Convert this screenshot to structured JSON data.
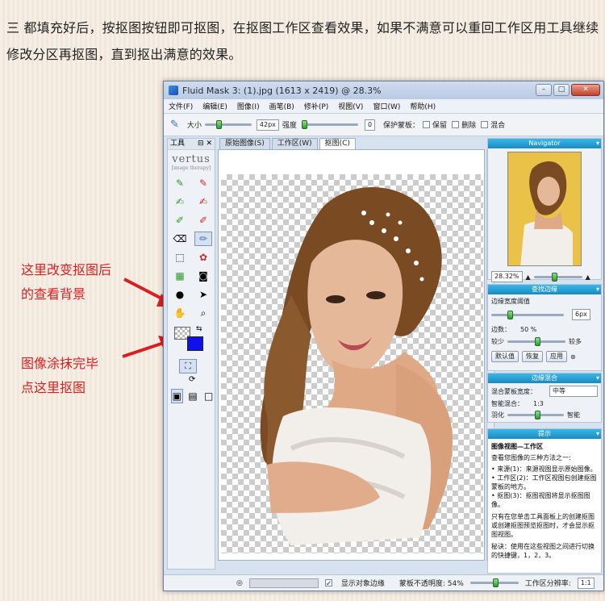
{
  "intro_text": "三 都填充好后，按抠图按钮即可抠图，在抠图工作区查看效果，如果不满意可以重回工作区用工具继续修改分区再抠图，直到抠出满意的效果。",
  "annotations": {
    "first_line1": "这里改变抠图后",
    "first_line2": "的查看背景",
    "second_line1": "图像涂抹完毕",
    "second_line2": "点这里抠图"
  },
  "window": {
    "title": "Fluid Mask 3: (1).jpg (1613 x 2419) @ 28.3%",
    "menu": [
      "文件(F)",
      "编辑(E)",
      "图像(I)",
      "画笔(B)",
      "修补(P)",
      "视图(V)",
      "窗口(W)",
      "帮助(H)"
    ],
    "options": {
      "size_label": "大小",
      "size_value": "42px",
      "strength_label": "强度",
      "strength_value": "0",
      "protect_label": "保护蒙板：",
      "keep_label": "保留",
      "delete_label": "删除",
      "blend_label": "混合"
    },
    "tools_title": "工具",
    "logo": "vertus",
    "logo_sub": "[image therapy]",
    "tabs": [
      "原始图像(S)",
      "工作区(W)",
      "抠图(C)"
    ],
    "navigator": {
      "title": "Navigator",
      "zoom": "28.32%"
    },
    "edge_panel": {
      "title": "查找边缘",
      "threshold_label": "边缘宽度阈值",
      "threshold_value": "6px",
      "contrast_label": "边数：",
      "contrast_value": "50 %",
      "less": "较少",
      "more": "较多",
      "btn_default": "默认值",
      "btn_restore": "恢复",
      "btn_apply": "应用"
    },
    "blend_panel": {
      "title": "边缘混合",
      "mask_label": "混合蒙板宽度：",
      "mask_value": "中等",
      "ratio_label": "智能混合：",
      "ratio_value": "1:3",
      "feather_label": "羽化",
      "smart_label": "智能"
    },
    "hint_panel": {
      "title": "提示",
      "heading": "图像视图—工作区",
      "line1": "查看您图像的三种方法之一:",
      "bullet1": "• 来源(1)：来源视图显示原始图像。",
      "bullet2": "• 工作区(2)：工作区视图包创建抠图蒙板的地方。",
      "bullet3": "• 抠图(3)：抠图视图将显示抠图图像。",
      "para": "只有在您单击工具面板上的创建抠图或创建抠图预览抠图时，才会显示抠图视图。",
      "tip": "秘诀：使用在这些视图之间进行切换的快捷键，1，2，3。"
    },
    "status": {
      "show_edges": "显示对象边缘",
      "opacity": "蒙板不透明度: 54%",
      "res_label": "工作区分辨率:",
      "res_value": "1:1"
    }
  }
}
